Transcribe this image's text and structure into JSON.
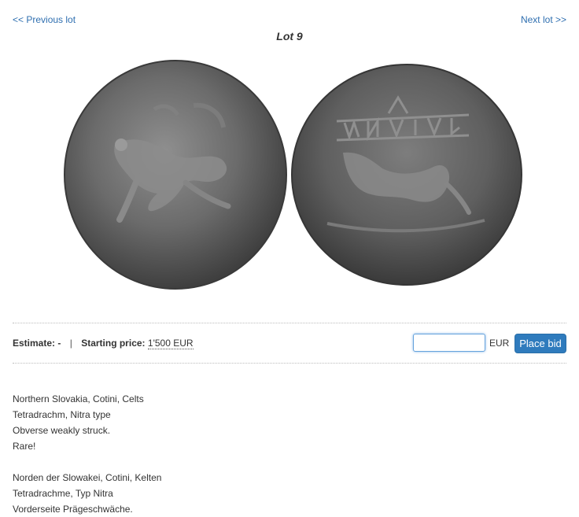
{
  "nav": {
    "previous": "<< Previous lot",
    "next": "Next lot >>"
  },
  "lot": {
    "title": "Lot 9"
  },
  "pricing": {
    "estimate_label": "Estimate:",
    "estimate_value": "-",
    "separator": "|",
    "starting_label": "Starting price:",
    "starting_value": "1'500 EUR"
  },
  "bid": {
    "input_value": "",
    "currency": "EUR",
    "button_label": "Place bid"
  },
  "description": {
    "english": [
      "Northern Slovakia, Cotini, Celts",
      "Tetradrachm, Nitra type",
      "Obverse weakly struck.",
      "Rare!"
    ],
    "german": [
      "Norden der Slowakei, Cotini, Kelten",
      "Tetradrachme, Typ Nitra",
      "Vorderseite Prägeschwäche."
    ]
  },
  "image": {
    "coin_colors": {
      "obverse": "#6b6b6b",
      "reverse": "#626262",
      "highlight": "#8a8a8a",
      "shadow": "#444444"
    }
  }
}
